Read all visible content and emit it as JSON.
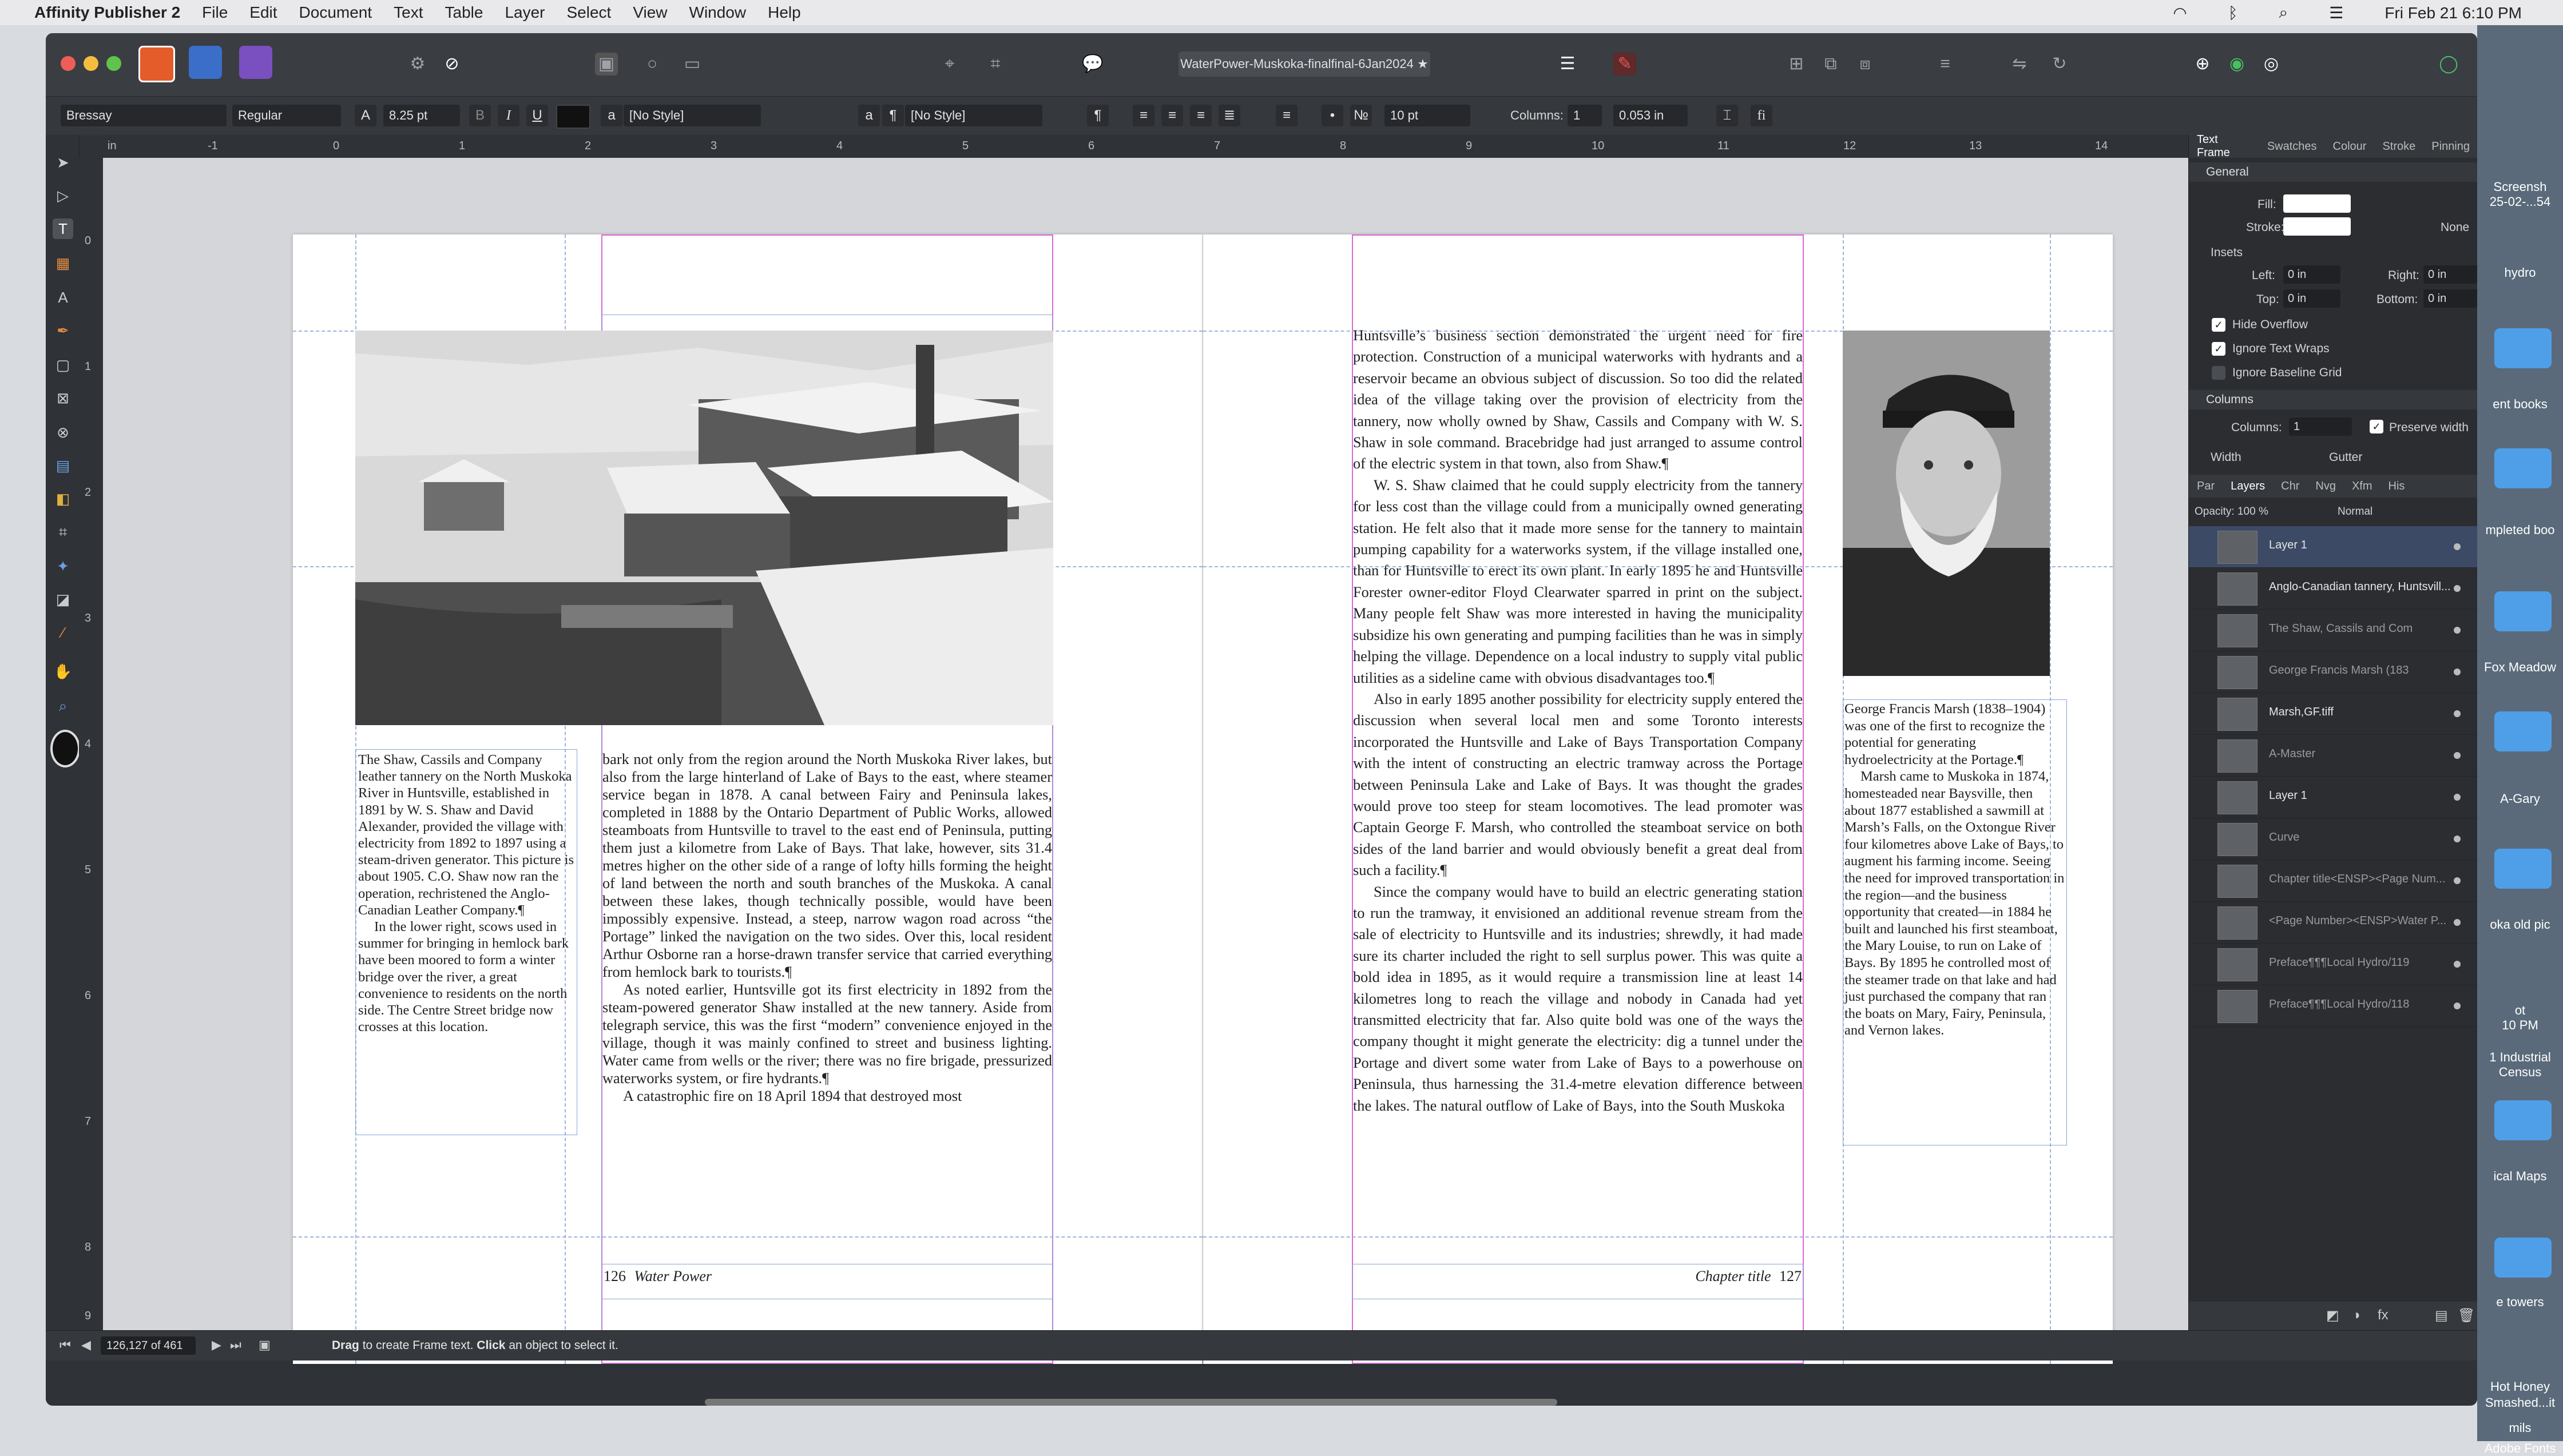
{
  "menubar": {
    "app": "Affinity Publisher 2",
    "items": [
      "File",
      "Edit",
      "Document",
      "Text",
      "Table",
      "Layer",
      "Select",
      "View",
      "Window",
      "Help"
    ],
    "clock": "Fri Feb 21  6:10 PM"
  },
  "window": {
    "doc_title": "WaterPower-Muskoka-finalfinal-6Jan2024 ★"
  },
  "ctxbar": {
    "font": "Bressay",
    "style": "Regular",
    "size": "8.25 pt",
    "para_style": "[No Style]",
    "char_style": "[No Style]",
    "spacing": "10 pt",
    "columns_label": "Columns:",
    "columns": "1",
    "gutter": "0.053 in",
    "bold": "B",
    "italic": "I",
    "underline": "U",
    "para_mark": "¶",
    "fi": "fi"
  },
  "ruler": {
    "unit": "in",
    "h": [
      "-1",
      "0",
      "1",
      "2",
      "3",
      "4",
      "5",
      "6",
      "7",
      "8",
      "9",
      "10",
      "11",
      "12",
      "13",
      "14"
    ],
    "v": [
      "0",
      "1",
      "2",
      "3",
      "4",
      "5",
      "6",
      "7",
      "8",
      "9"
    ]
  },
  "spread": {
    "caption": {
      "p1": "The Shaw, Cassils and Company leather tannery on the North Muskoka River in Huntsville, established in 1891 by W. S. Shaw and David Alexander, provided the village with electricity from 1892 to 1897 using a steam-driven generator. This picture is about 1905. C.O. Shaw now ran the operation, rechristened the Anglo-Canadian Leather Company.¶",
      "p2": "In the lower right, scows used in summer for bringing in hemlock bark have been moored to form a winter bridge over the river, a great convenience to residents on the north side. The Centre Street bridge now crosses at this location."
    },
    "left_body": {
      "p1": "bark not only from the region around the North Muskoka River lakes, but also from the large hinterland of Lake of Bays to the east, where steamer service began in 1878. A canal between Fairy and Peninsula lakes, completed in 1888 by the Ontario Department of Public Works, allowed steamboats from Huntsville to travel to the east end of Peninsula, putting them just a kilometre from Lake of Bays. That lake, however, sits 31.4 metres higher on the other side of a range of lofty hills forming the height of land between the north and south branches of the Muskoka. A canal between these lakes, though technically possible, would have been impossibly expensive. Instead, a steep, narrow wagon road across “the Portage” linked the navigation on the two sides. Over this, local resident Arthur Osborne ran a horse-drawn transfer service that carried everything from hemlock bark to tourists.¶",
      "p2": "As noted earlier, Huntsville got its first electricity in 1892 from the steam-powered generator Shaw installed at the new tannery. Aside from telegraph service, this was the first “modern” convenience enjoyed in the village, though it was mainly confined to street and business lighting. Water came from wells or the river; there was no fire brigade, pressurized waterworks system, or fire hydrants.¶",
      "p3": "A catastrophic fire on 18 April 1894 that destroyed most"
    },
    "left_footer": {
      "num": "126",
      "title": "Water Power"
    },
    "right_body": {
      "p1": "Huntsville’s business section demonstrated the urgent need for fire protection. Construction of a municipal waterworks with hydrants and a reservoir became an obvious subject of discussion. So too did the related idea of the village taking over the provision of electricity from the tannery, now wholly owned by Shaw, Cassils and Company with W. S. Shaw in sole command. Bracebridge had just arranged to assume control of the electric system in that town, also from Shaw.¶",
      "p2": "W. S. Shaw claimed that he could supply electricity from the tannery for less cost than the village could from a municipally owned generating station. He felt also that it made more sense for the tannery to maintain pumping capability for a waterworks system, if the village installed one, than for Huntsville to erect its own plant. In early 1895 he and Huntsville Forester owner-editor Floyd Clearwater sparred in print on the subject. Many people felt Shaw was more interested in having the municipality subsidize his own generating and pumping facilities than he was in simply helping the village. Dependence on a local industry to supply vital public utilities as a sideline came with obvious disadvantages too.¶",
      "p3": "Also in early 1895 another possibility for electricity supply entered the discussion when several local men and some Toronto interests incorporated the Huntsville and Lake of Bays Transportation Company with the intent of constructing an electric tramway across the Portage between Peninsula Lake and Lake of Bays. It was thought the grades would prove too steep for steam locomotives. The lead promoter was Captain George F. Marsh, who controlled the steamboat service on both sides of the land barrier and would obviously benefit a great deal from such a facility.¶",
      "p4": "Since the company would have to build an electric generating station to run the tramway, it envisioned an additional revenue stream from the sale of electricity to Huntsville and its industries; shrewdly, it had made sure its charter included the right to sell surplus power. This was quite a bold idea in 1895, as it would require a transmission line at least 14 kilometres long to reach the village and nobody in Canada had yet transmitted electricity that far. Also quite bold was one of the ways the company thought it might generate the electricity: dig a tunnel under the Portage and divert some water from Lake of Bays to a powerhouse on Peninsula, thus harnessing the 31.4-metre elevation difference between the lakes. The natural outflow of Lake of Bays, into the South Muskoka"
    },
    "right_footer": {
      "title": "Chapter title",
      "num": "127"
    },
    "portrait_caption": {
      "p1": "George Francis Marsh (1838–1904) was one of the first to recognize the potential for generating hydroelectricity at the Portage.¶",
      "p2": "Marsh came to Muskoka in 1874, homesteaded near Baysville, then about 1877 established a sawmill at Marsh’s Falls, on the Oxtongue River four kilometres above Lake of Bays, to augment his farming income. Seeing the need for improved transportation in the region—and the business opportunity that created—in 1884 he built and launched his first steamboat, the Mary Louise, to run on Lake of Bays. By 1895 he controlled most of the steamer trade on that lake and had just purchased the company that ran the boats on Mary, Fairy, Peninsula, and Vernon lakes."
    }
  },
  "panel_top": {
    "tabs": [
      "Text Frame",
      "Swatches",
      "Colour",
      "Stroke",
      "Pinning"
    ],
    "general": "General",
    "fill": "Fill:",
    "stroke": "Stroke:",
    "none": "None",
    "insets": "Insets",
    "left": "Left:",
    "left_v": "0 in",
    "right": "Right:",
    "right_v": "0 in",
    "top": "Top:",
    "top_v": "0 in",
    "bottom": "Bottom:",
    "bottom_v": "0 in",
    "hide_overflow": "Hide Overflow",
    "ignore_wraps": "Ignore Text Wraps",
    "ignore_grid": "Ignore Baseline Grid",
    "columns_sect": "Columns",
    "columns": "Columns:",
    "columns_v": "1",
    "preserve_width": "Preserve width",
    "width": "Width",
    "gutter": "Gutter"
  },
  "panel_layers": {
    "tabs": [
      "Par",
      "Layers",
      "Chr",
      "Nvg",
      "Xfm",
      "His"
    ],
    "opacity": "Opacity:  100 %",
    "blend": "Normal",
    "layers": [
      "Layer 1",
      "Anglo-Canadian tannery, Huntsvill...",
      "The Shaw, Cassils and Com",
      "George Francis Marsh (183",
      "Marsh,GF.tiff",
      "A-Master",
      "Layer 1",
      "Curve",
      "Chapter title<ENSP><Page Num...",
      "<Page Number><ENSP>Water P...",
      "Preface¶¶¶Local Hydro/119",
      "Preface¶¶¶Local Hydro/118"
    ]
  },
  "status": {
    "page": "126,127 of 461",
    "hint_drag": "Drag",
    "hint_mid": "to create Frame text.",
    "hint_click": "Click",
    "hint_end": "an object to select it."
  },
  "desktop": {
    "items": [
      "Screensh",
      "25-02-...54",
      "hydro",
      "ent books",
      "mpleted boo",
      "Fox Meadow",
      "A-Gary",
      "oka old pic",
      "ot",
      "10 PM",
      "1 Industrial",
      "Census",
      "ical Maps",
      "e towers",
      "Hot Honey",
      "Smashed...it",
      "mils",
      "Adobe Fonts"
    ]
  }
}
